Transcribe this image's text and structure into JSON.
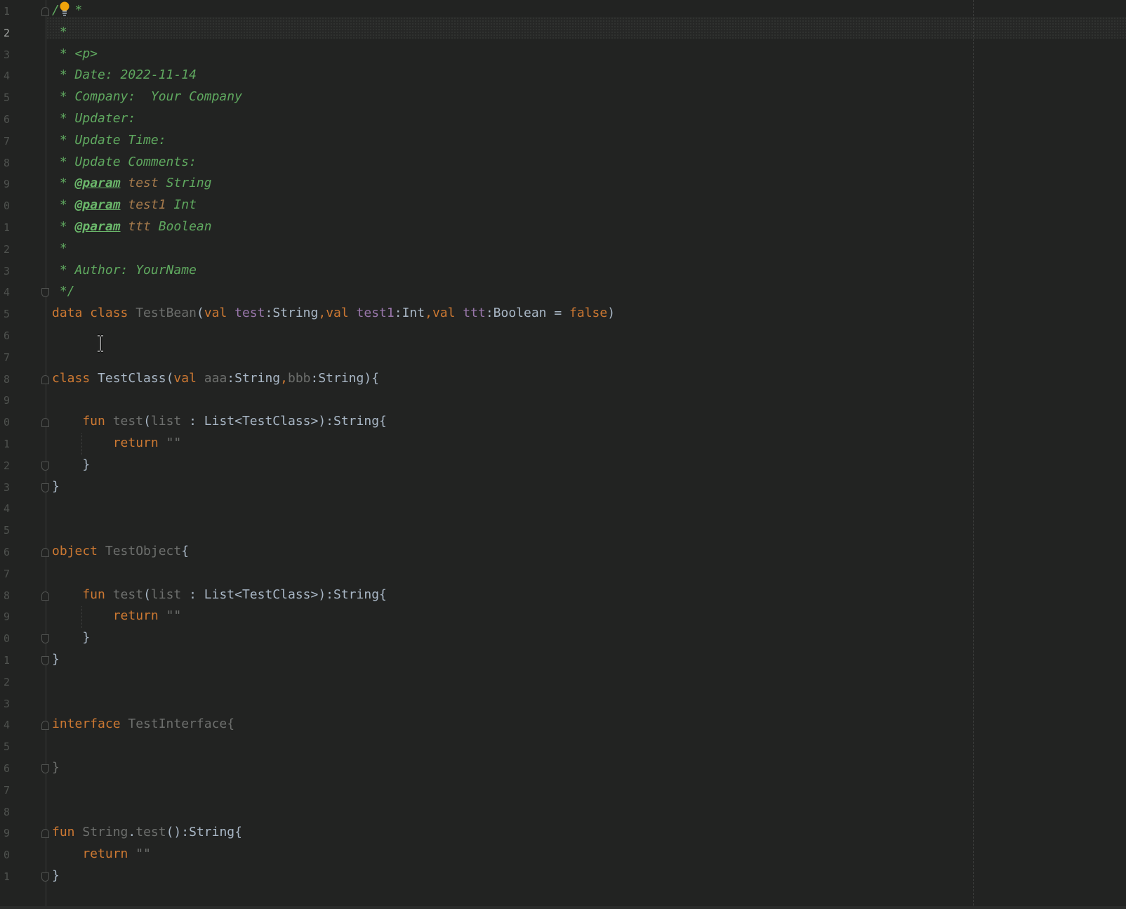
{
  "editor": {
    "current_line_number": "2",
    "line_numbers": [
      "1",
      "2",
      "3",
      "4",
      "5",
      "6",
      "7",
      "8",
      "9",
      "0",
      "1",
      "2",
      "3",
      "4",
      "5",
      "6",
      "7",
      "8",
      "9",
      "0",
      "1",
      "2",
      "3",
      "4",
      "5",
      "6",
      "7",
      "8",
      "9",
      "0",
      "1",
      "2",
      "3",
      "4",
      "5",
      "6",
      "7",
      "8",
      "9",
      "0",
      "1"
    ],
    "icons": {
      "intention_bulb": "lightbulb-icon",
      "text_cursor": "i-beam-cursor-icon",
      "fold_marker": "fold-marker-icon"
    },
    "colors": {
      "background": "#222322",
      "comment": "#5fa85f",
      "keyword": "#cc7832",
      "property": "#9876aa",
      "bulb": "#f0a30a"
    },
    "lines": [
      {
        "tokens": [
          {
            "t": "/",
            "c": "comment"
          },
          {
            "t": "  *",
            "c": "comment"
          }
        ]
      },
      {
        "tokens": [
          {
            "t": " *",
            "c": "comment"
          }
        ]
      },
      {
        "tokens": [
          {
            "t": " * <p>",
            "c": "comment"
          }
        ]
      },
      {
        "tokens": [
          {
            "t": " * Date: 2022-11-14",
            "c": "comment"
          }
        ]
      },
      {
        "tokens": [
          {
            "t": " * Company:  Your Company",
            "c": "comment"
          }
        ]
      },
      {
        "tokens": [
          {
            "t": " * Updater:",
            "c": "comment"
          }
        ]
      },
      {
        "tokens": [
          {
            "t": " * Update Time:",
            "c": "comment"
          }
        ]
      },
      {
        "tokens": [
          {
            "t": " * Update Comments:",
            "c": "comment"
          }
        ]
      },
      {
        "tokens": [
          {
            "t": " * ",
            "c": "comment"
          },
          {
            "t": "@param",
            "c": "doctag"
          },
          {
            "t": " test",
            "c": "docname"
          },
          {
            "t": " String",
            "c": "comment"
          }
        ]
      },
      {
        "tokens": [
          {
            "t": " * ",
            "c": "comment"
          },
          {
            "t": "@param",
            "c": "doctag"
          },
          {
            "t": " test1",
            "c": "docname"
          },
          {
            "t": " Int",
            "c": "comment"
          }
        ]
      },
      {
        "tokens": [
          {
            "t": " * ",
            "c": "comment"
          },
          {
            "t": "@param",
            "c": "doctag"
          },
          {
            "t": " ttt",
            "c": "docname"
          },
          {
            "t": " Boolean",
            "c": "comment"
          }
        ]
      },
      {
        "tokens": [
          {
            "t": " *",
            "c": "comment"
          }
        ]
      },
      {
        "tokens": [
          {
            "t": " * Author: YourName",
            "c": "comment"
          }
        ]
      },
      {
        "tokens": [
          {
            "t": " */",
            "c": "comment"
          }
        ]
      },
      {
        "tokens": [
          {
            "t": "data class ",
            "c": "kw"
          },
          {
            "t": "TestBean",
            "c": "dim"
          },
          {
            "t": "(",
            "c": "plain"
          },
          {
            "t": "val ",
            "c": "kw"
          },
          {
            "t": "test",
            "c": "prop"
          },
          {
            "t": ":String",
            "c": "plain"
          },
          {
            "t": ",",
            "c": "punc"
          },
          {
            "t": "val ",
            "c": "kw"
          },
          {
            "t": "test1",
            "c": "prop"
          },
          {
            "t": ":Int",
            "c": "plain"
          },
          {
            "t": ",",
            "c": "punc"
          },
          {
            "t": "val ",
            "c": "kw"
          },
          {
            "t": "ttt",
            "c": "prop"
          },
          {
            "t": ":Boolean = ",
            "c": "plain"
          },
          {
            "t": "false",
            "c": "kw"
          },
          {
            "t": ")",
            "c": "plain"
          }
        ]
      },
      {
        "tokens": []
      },
      {
        "tokens": []
      },
      {
        "tokens": [
          {
            "t": "class ",
            "c": "kw"
          },
          {
            "t": "TestClass(",
            "c": "plain"
          },
          {
            "t": "val ",
            "c": "kw"
          },
          {
            "t": "aaa",
            "c": "dim"
          },
          {
            "t": ":String",
            "c": "plain"
          },
          {
            "t": ",",
            "c": "punc"
          },
          {
            "t": "bbb",
            "c": "dim"
          },
          {
            "t": ":String){",
            "c": "plain"
          }
        ]
      },
      {
        "tokens": []
      },
      {
        "tokens": [
          {
            "t": "    fun ",
            "c": "kw"
          },
          {
            "t": "test",
            "c": "dim"
          },
          {
            "t": "(",
            "c": "plain"
          },
          {
            "t": "list",
            "c": "dim"
          },
          {
            "t": " : List<TestClass>):String{",
            "c": "plain"
          }
        ]
      },
      {
        "tokens": [
          {
            "t": "        return ",
            "c": "kw"
          },
          {
            "t": "\"\"",
            "c": "dim"
          }
        ]
      },
      {
        "tokens": [
          {
            "t": "    }",
            "c": "plain"
          }
        ]
      },
      {
        "tokens": [
          {
            "t": "}",
            "c": "plain"
          }
        ]
      },
      {
        "tokens": []
      },
      {
        "tokens": []
      },
      {
        "tokens": [
          {
            "t": "object ",
            "c": "kw"
          },
          {
            "t": "TestObject",
            "c": "dim"
          },
          {
            "t": "{",
            "c": "plain"
          }
        ]
      },
      {
        "tokens": []
      },
      {
        "tokens": [
          {
            "t": "    fun ",
            "c": "kw"
          },
          {
            "t": "test",
            "c": "dim"
          },
          {
            "t": "(",
            "c": "plain"
          },
          {
            "t": "list",
            "c": "dim"
          },
          {
            "t": " : List<TestClass>):String{",
            "c": "plain"
          }
        ]
      },
      {
        "tokens": [
          {
            "t": "        return ",
            "c": "kw"
          },
          {
            "t": "\"\"",
            "c": "dim"
          }
        ]
      },
      {
        "tokens": [
          {
            "t": "    }",
            "c": "plain"
          }
        ]
      },
      {
        "tokens": [
          {
            "t": "}",
            "c": "plain"
          }
        ]
      },
      {
        "tokens": []
      },
      {
        "tokens": []
      },
      {
        "tokens": [
          {
            "t": "interface ",
            "c": "kw"
          },
          {
            "t": "TestInterface{",
            "c": "dim"
          }
        ]
      },
      {
        "tokens": []
      },
      {
        "tokens": [
          {
            "t": "}",
            "c": "dim"
          }
        ]
      },
      {
        "tokens": []
      },
      {
        "tokens": []
      },
      {
        "tokens": [
          {
            "t": "fun ",
            "c": "kw"
          },
          {
            "t": "String",
            "c": "dim"
          },
          {
            "t": ".",
            "c": "plain"
          },
          {
            "t": "test",
            "c": "dim"
          },
          {
            "t": "():String{",
            "c": "plain"
          }
        ]
      },
      {
        "tokens": [
          {
            "t": "    return ",
            "c": "kw"
          },
          {
            "t": "\"\"",
            "c": "dim"
          }
        ]
      },
      {
        "tokens": [
          {
            "t": "}",
            "c": "plain"
          }
        ]
      }
    ]
  }
}
